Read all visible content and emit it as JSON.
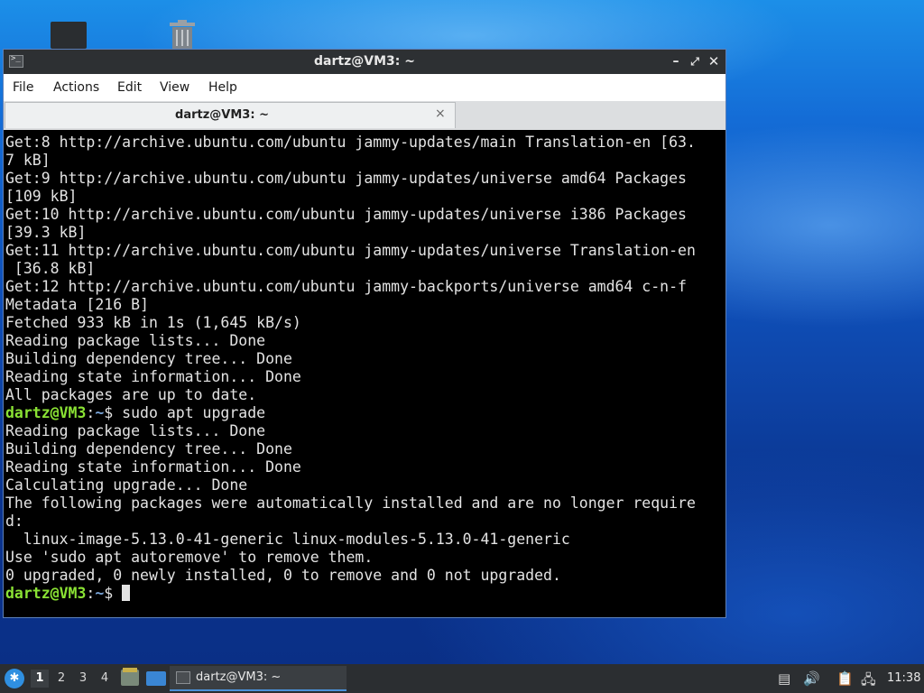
{
  "window": {
    "title": "dartz@VM3: ~",
    "controls": {
      "minimize": "–",
      "maximize": "⤢",
      "close": "✕"
    }
  },
  "menubar": {
    "items": [
      "File",
      "Actions",
      "Edit",
      "View",
      "Help"
    ]
  },
  "tabs": [
    {
      "label": "dartz@VM3: ~",
      "close": "×"
    }
  ],
  "terminal": {
    "prompt_user": "dartz@VM3",
    "prompt_sep": ":",
    "prompt_path": "~",
    "prompt_symbol": "$ ",
    "lines": [
      "Get:8 http://archive.ubuntu.com/ubuntu jammy-updates/main Translation-en [63.",
      "7 kB]",
      "Get:9 http://archive.ubuntu.com/ubuntu jammy-updates/universe amd64 Packages",
      "[109 kB]",
      "Get:10 http://archive.ubuntu.com/ubuntu jammy-updates/universe i386 Packages",
      "[39.3 kB]",
      "Get:11 http://archive.ubuntu.com/ubuntu jammy-updates/universe Translation-en",
      " [36.8 kB]",
      "Get:12 http://archive.ubuntu.com/ubuntu jammy-backports/universe amd64 c-n-f",
      "Metadata [216 B]",
      "Fetched 933 kB in 1s (1,645 kB/s)",
      "Reading package lists... Done",
      "Building dependency tree... Done",
      "Reading state information... Done",
      "All packages are up to date."
    ],
    "command": "sudo apt upgrade",
    "lines2": [
      "Reading package lists... Done",
      "Building dependency tree... Done",
      "Reading state information... Done",
      "Calculating upgrade... Done",
      "The following packages were automatically installed and are no longer require",
      "d:",
      "  linux-image-5.13.0-41-generic linux-modules-5.13.0-41-generic",
      "Use 'sudo apt autoremove' to remove them.",
      "0 upgraded, 0 newly installed, 0 to remove and 0 not upgraded."
    ]
  },
  "taskbar": {
    "workspaces": [
      "1",
      "2",
      "3",
      "4"
    ],
    "active_workspace": "1",
    "task_label": "dartz@VM3: ~",
    "clock": "11:38"
  }
}
